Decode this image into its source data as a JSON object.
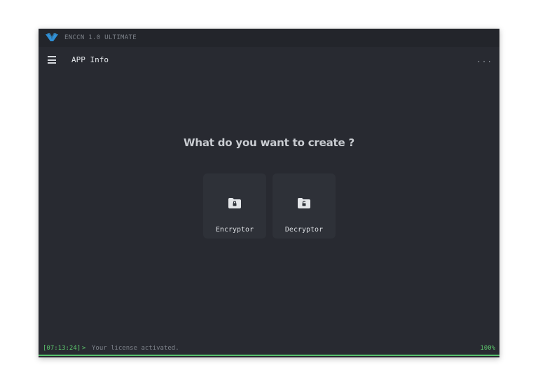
{
  "window": {
    "title": "ENCCN 1.0 ULTIMATE"
  },
  "toolbar": {
    "app_info_label": "APP Info",
    "more_label": "..."
  },
  "main": {
    "prompt": "What do you want to create ?",
    "cards": [
      {
        "label": "Encryptor",
        "icon": "locked-folder-icon"
      },
      {
        "label": "Decryptor",
        "icon": "unlocked-folder-icon"
      }
    ]
  },
  "status": {
    "timestamp": "[07:13:24]",
    "chevron": ">",
    "message": "Your license activated.",
    "progress": "100%"
  },
  "colors": {
    "background": "#282a31",
    "titlebar": "#23252b",
    "accent_green": "#5cc46c",
    "logo_blue": "#2f8fd6"
  }
}
